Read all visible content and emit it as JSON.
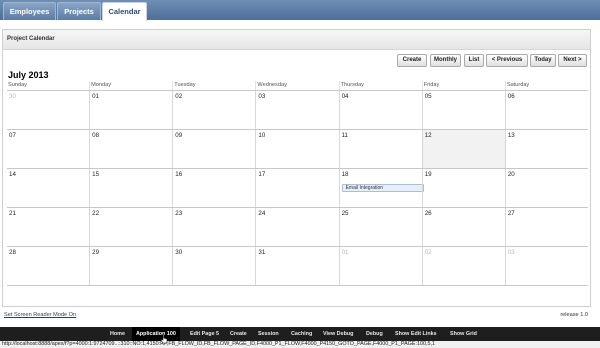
{
  "tabs": [
    {
      "label": "Employees"
    },
    {
      "label": "Projects"
    },
    {
      "label": "Calendar",
      "active": true
    }
  ],
  "region": {
    "title": "Project Calendar"
  },
  "toolbar": {
    "create": "Create",
    "monthly": "Monthly",
    "list": "List",
    "previous": "< Previous",
    "today": "Today",
    "next": "Next >"
  },
  "calendar": {
    "month_title": "July 2013",
    "days_of_week": [
      "Sunday",
      "Monday",
      "Tuesday",
      "Wednesday",
      "Thursday",
      "Friday",
      "Saturday"
    ],
    "weeks": [
      [
        {
          "d": "30",
          "other": true
        },
        {
          "d": "01"
        },
        {
          "d": "02"
        },
        {
          "d": "03"
        },
        {
          "d": "04"
        },
        {
          "d": "05"
        },
        {
          "d": "06"
        }
      ],
      [
        {
          "d": "07"
        },
        {
          "d": "08"
        },
        {
          "d": "09"
        },
        {
          "d": "10"
        },
        {
          "d": "11"
        },
        {
          "d": "12",
          "today": true
        },
        {
          "d": "13"
        }
      ],
      [
        {
          "d": "14"
        },
        {
          "d": "15"
        },
        {
          "d": "16"
        },
        {
          "d": "17"
        },
        {
          "d": "18",
          "event": "Email Integration"
        },
        {
          "d": "19"
        },
        {
          "d": "20"
        }
      ],
      [
        {
          "d": "21"
        },
        {
          "d": "22"
        },
        {
          "d": "23"
        },
        {
          "d": "24"
        },
        {
          "d": "25"
        },
        {
          "d": "26"
        },
        {
          "d": "27"
        }
      ],
      [
        {
          "d": "28"
        },
        {
          "d": "29"
        },
        {
          "d": "30"
        },
        {
          "d": "31"
        },
        {
          "d": "01",
          "other": true
        },
        {
          "d": "02",
          "other": true
        },
        {
          "d": "03",
          "other": true
        }
      ]
    ]
  },
  "footer": {
    "screen_reader_link": "Set Screen Reader Mode On",
    "release": "release 1.0"
  },
  "devbar": {
    "home": "Home",
    "application": "Application 100",
    "edit_page": "Edit Page 5",
    "create": "Create",
    "session": "Session",
    "caching": "Caching",
    "view_debug": "View Debug",
    "debug": "Debug",
    "show_edit_links": "Show Edit Links",
    "show_grid": "Show Grid"
  },
  "status_url": "http://localhost:8888/apex/f?p=4000:1:9724709...:310::NO:1,4150:RP,FB_FLOW_ID,FB_FLOW_PAGE_ID,F4000_P1_FLOW,F4000_P4150_GOTO_PAGE,F4000_P1_PAGE:100,5,1"
}
